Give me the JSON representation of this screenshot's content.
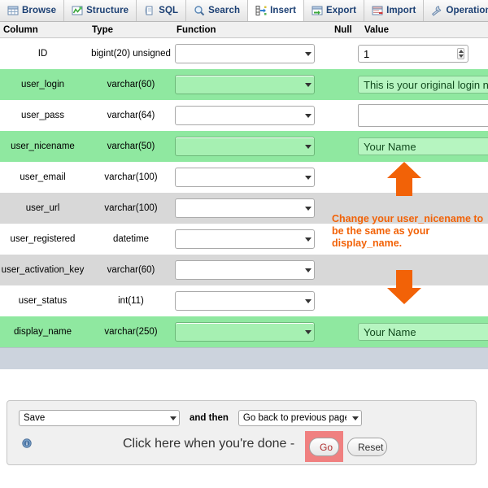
{
  "tabs": [
    {
      "label": "Browse",
      "icon": "table-icon",
      "active": false
    },
    {
      "label": "Structure",
      "icon": "structure-icon",
      "active": false
    },
    {
      "label": "SQL",
      "icon": "sql-document-icon",
      "active": false
    },
    {
      "label": "Search",
      "icon": "magnifier-icon",
      "active": false
    },
    {
      "label": "Insert",
      "icon": "insert-row-icon",
      "active": true
    },
    {
      "label": "Export",
      "icon": "export-icon",
      "active": false
    },
    {
      "label": "Import",
      "icon": "import-icon",
      "active": false
    },
    {
      "label": "Operation",
      "icon": "wrench-icon",
      "active": false
    }
  ],
  "table": {
    "headers": {
      "column": "Column",
      "type": "Type",
      "function": "Function",
      "null": "Null",
      "value": "Value"
    },
    "rows": [
      {
        "column": "ID",
        "type": "bigint(20) unsigned",
        "function": "",
        "null": "",
        "value": "1",
        "value_kind": "number",
        "style": "plain"
      },
      {
        "column": "user_login",
        "type": "varchar(60)",
        "function": "",
        "null": "",
        "value": "This is your original login name",
        "value_kind": "text",
        "style": "highlight"
      },
      {
        "column": "user_pass",
        "type": "varchar(64)",
        "function": "",
        "null": "",
        "value": "",
        "value_kind": "textarea",
        "style": "plain"
      },
      {
        "column": "user_nicename",
        "type": "varchar(50)",
        "function": "",
        "null": "",
        "value": "Your Name",
        "value_kind": "text",
        "style": "highlight"
      },
      {
        "column": "user_email",
        "type": "varchar(100)",
        "function": "",
        "null": "",
        "value": "",
        "value_kind": "none",
        "style": "plain"
      },
      {
        "column": "user_url",
        "type": "varchar(100)",
        "function": "",
        "null": "",
        "value": "",
        "value_kind": "none",
        "style": "alt"
      },
      {
        "column": "user_registered",
        "type": "datetime",
        "function": "",
        "null": "",
        "value": "",
        "value_kind": "none",
        "style": "plain"
      },
      {
        "column": "user_activation_key",
        "type": "varchar(60)",
        "function": "",
        "null": "",
        "value": "",
        "value_kind": "none",
        "style": "alt"
      },
      {
        "column": "user_status",
        "type": "int(11)",
        "function": "",
        "null": "",
        "value": "",
        "value_kind": "none",
        "style": "plain"
      },
      {
        "column": "display_name",
        "type": "varchar(250)",
        "function": "",
        "null": "",
        "value": "Your Name",
        "value_kind": "text",
        "style": "highlight"
      }
    ]
  },
  "annotation": {
    "text": "Change your user_nicename to be the same as your display_name.",
    "color": "#f26207",
    "arrow_up": "up-arrow-annotation",
    "arrow_down": "down-arrow-annotation"
  },
  "bottom_panel": {
    "save_select": "Save",
    "and_then_label": "and then",
    "after_select": "Go back to previous page",
    "done_text": "Click here when you're done -",
    "go_button": "Go",
    "reset_button": "Reset",
    "go_highlight_color": "#f08080"
  },
  "colors": {
    "highlight_row": "#8fe8a0",
    "alt_row": "#d8d8d8",
    "footer_row": "#ccd3dd",
    "tab_label": "#1b3f73"
  }
}
